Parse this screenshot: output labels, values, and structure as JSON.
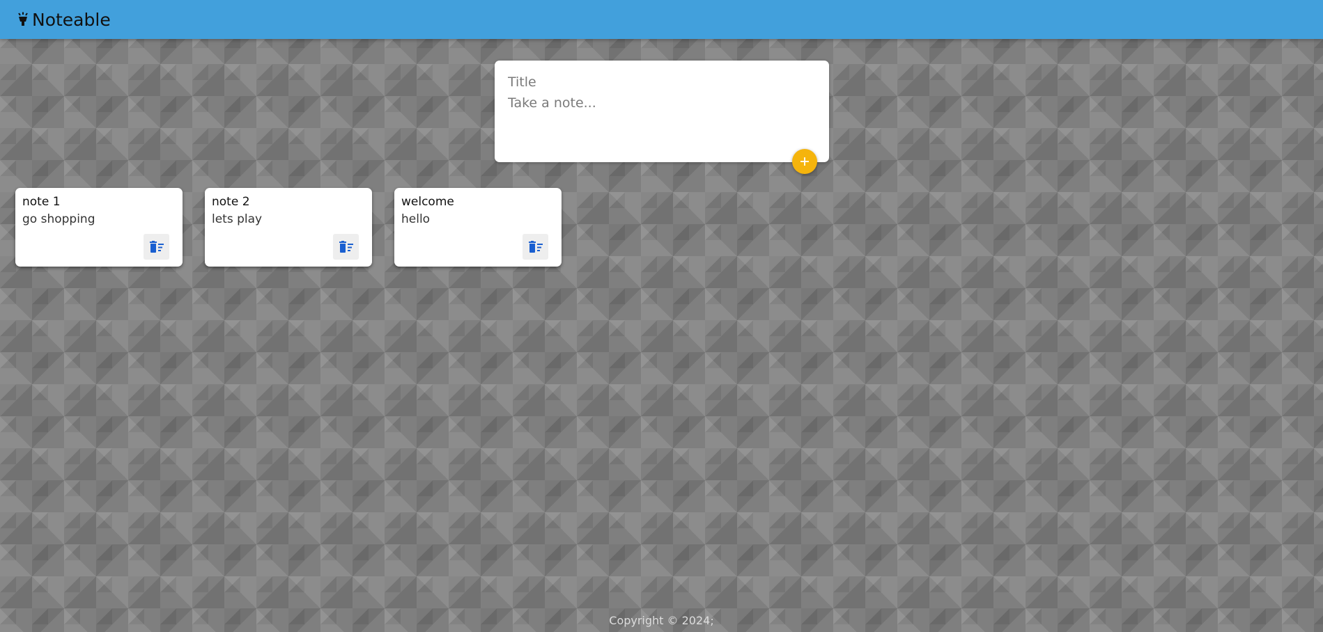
{
  "header": {
    "title": "Noteable",
    "icon": "lamp-icon",
    "background_color": "#42a0dc"
  },
  "compose": {
    "title_placeholder": "Title",
    "body_placeholder": "Take a note...",
    "add_button_icon": "plus-icon",
    "add_button_color": "#f5b40c"
  },
  "notes": [
    {
      "title": "note 1",
      "body": "go shopping",
      "delete_icon": "delete-sweep-icon"
    },
    {
      "title": "note 2",
      "body": "lets play",
      "delete_icon": "delete-sweep-icon"
    },
    {
      "title": "welcome",
      "body": "hello",
      "delete_icon": "delete-sweep-icon"
    }
  ],
  "footer": {
    "copyright": "Copyright © 2024;"
  },
  "colors": {
    "delete_icon": "#1a5fd0"
  }
}
